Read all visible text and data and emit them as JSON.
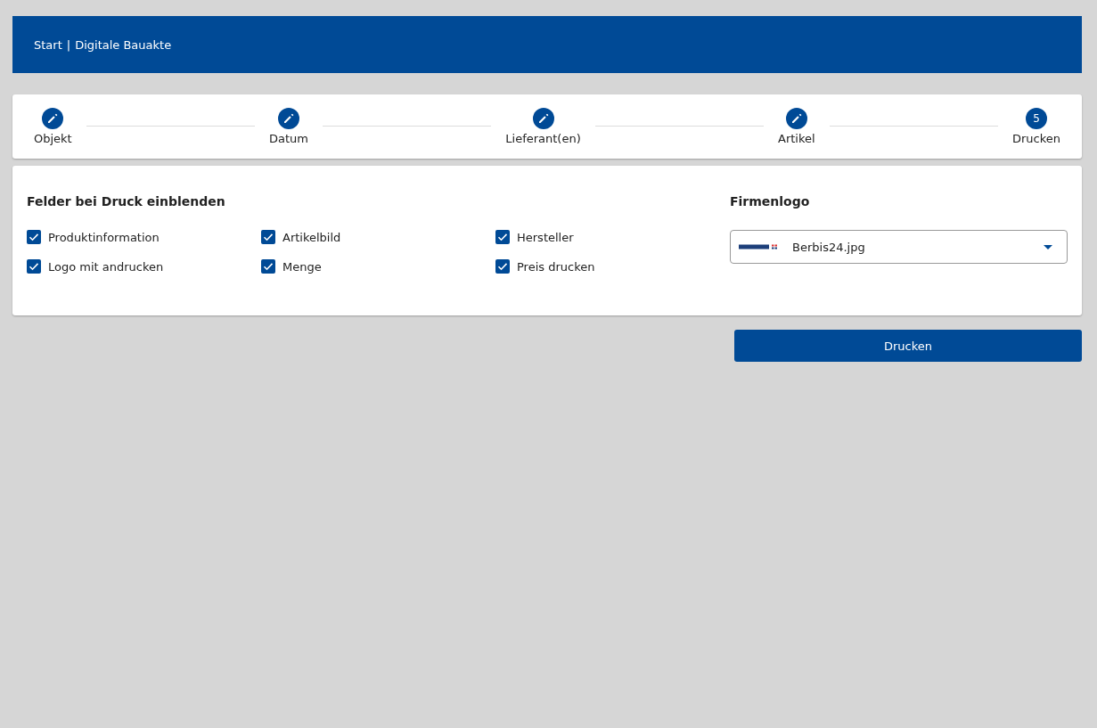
{
  "breadcrumb": {
    "items": [
      "Start",
      "Digitale Bauakte"
    ],
    "separator": "|"
  },
  "steps": [
    {
      "label": "Objekt",
      "kind": "done"
    },
    {
      "label": "Datum",
      "kind": "done"
    },
    {
      "label": "Lieferant(en)",
      "kind": "done"
    },
    {
      "label": "Artikel",
      "kind": "done"
    },
    {
      "label": "Drucken",
      "kind": "current",
      "number": "5"
    }
  ],
  "fields": {
    "title": "Felder bei Druck einblenden",
    "options": [
      {
        "label": "Produktinformation",
        "checked": true
      },
      {
        "label": "Artikelbild",
        "checked": true
      },
      {
        "label": "Hersteller",
        "checked": true
      },
      {
        "label": "Logo mit andrucken",
        "checked": true
      },
      {
        "label": "Menge",
        "checked": true
      },
      {
        "label": "Preis drucken",
        "checked": true
      }
    ]
  },
  "logo": {
    "title": "Firmenlogo",
    "value": "Berbis24.jpg"
  },
  "buttons": [
    "Drucken"
  ]
}
